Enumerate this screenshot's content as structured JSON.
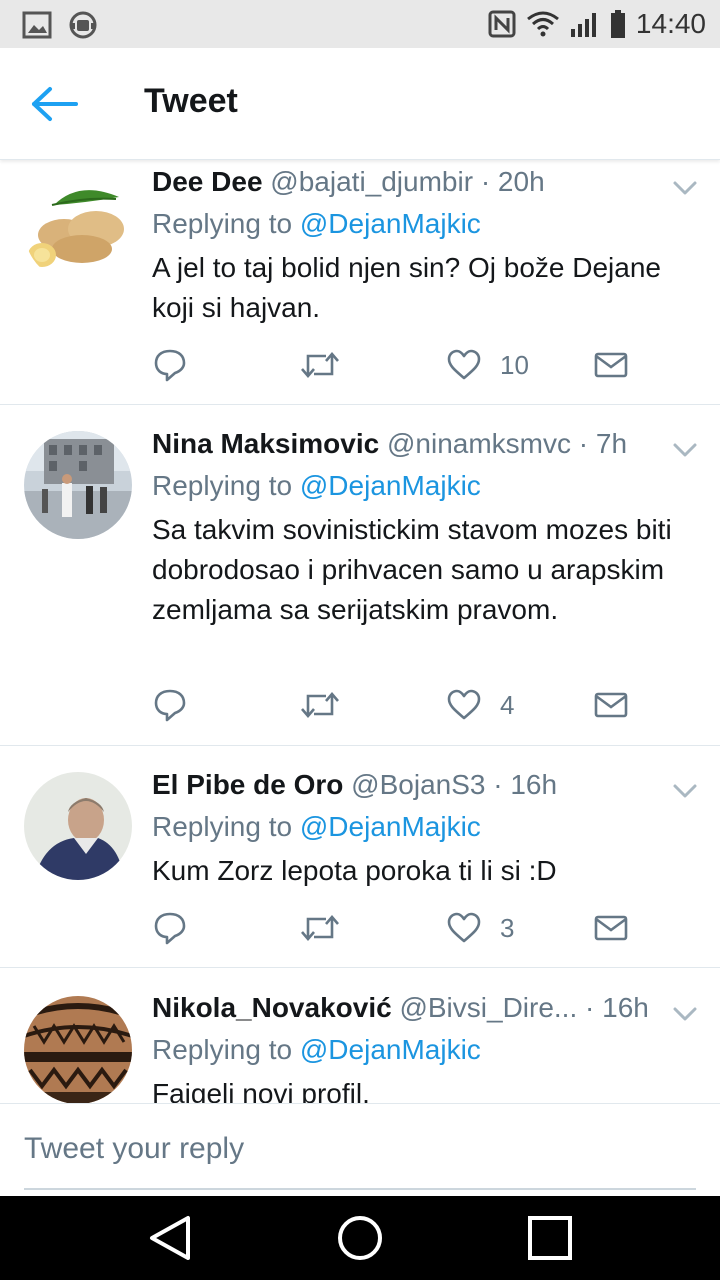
{
  "status_bar": {
    "time": "14:40"
  },
  "header": {
    "title": "Tweet",
    "back_icon": "arrow-left-icon"
  },
  "colors": {
    "accent": "#1da1f2",
    "mention": "#1b95e0",
    "text": "#14171a",
    "muted": "#657786",
    "divider": "#e1e8ed"
  },
  "tweets": [
    {
      "name": "Dee Dee",
      "meta": "@bajati_djumbir · 20h",
      "replying_prefix": "Replying to ",
      "replying_to": "@DejanMajkic",
      "body": "A jel to taj bolid njen sin? Oj bože Dejane koji si hajvan.",
      "likes": "10"
    },
    {
      "name": "Nina Maksimovic",
      "meta": "@ninamksmvc · 7h",
      "replying_prefix": "Replying to ",
      "replying_to": "@DejanMajkic",
      "body": "Sa takvim sovinistickim stavom mozes biti dobrodosao i prihvacen samo u arapskim zemljama sa serijatskim pravom.",
      "likes": "4"
    },
    {
      "name": "El Pibe de Oro",
      "meta": "@BojanS3 · 16h",
      "replying_prefix": "Replying to ",
      "replying_to": "@DejanMajkic",
      "body": "Kum Zorz lepota poroka ti li si :D",
      "likes": "3"
    },
    {
      "name": "Nikola_Novaković",
      "meta": "@Bivsi_Dire... · 16h",
      "replying_prefix": "Replying to ",
      "replying_to": "@DejanMajkic",
      "body": "Fajgeli novi profil.",
      "likes": ""
    }
  ],
  "composer": {
    "placeholder": "Tweet your reply"
  },
  "nav": {
    "back_icon": "nav-back-triangle-icon",
    "home_icon": "nav-home-circle-icon",
    "recents_icon": "nav-recents-square-icon"
  }
}
